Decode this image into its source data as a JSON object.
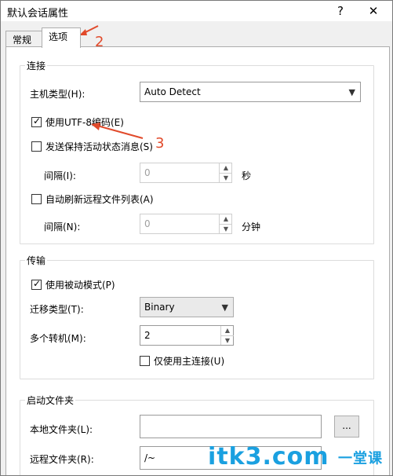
{
  "window": {
    "title": "默认会话属性",
    "help_btn": "?",
    "close_btn": "✕"
  },
  "tabs": [
    {
      "label": "常规"
    },
    {
      "label": "选项"
    }
  ],
  "annotations": {
    "a2": "2",
    "a3": "3"
  },
  "connection": {
    "group_title": "连接",
    "host_type_label": "主机类型(H):",
    "host_type_value": "Auto Detect",
    "utf8_label": "使用UTF-8编码(E)",
    "utf8_checked": true,
    "keepalive_label": "发送保持活动状态消息(S)",
    "keepalive_checked": false,
    "interval1_label": "间隔(I):",
    "interval1_value": "0",
    "interval1_unit": "秒",
    "autorefresh_label": "自动刷新远程文件列表(A)",
    "autorefresh_checked": false,
    "interval2_label": "间隔(N):",
    "interval2_value": "0",
    "interval2_unit": "分钟"
  },
  "transfer": {
    "group_title": "传输",
    "passive_label": "使用被动模式(P)",
    "passive_checked": true,
    "type_label": "迁移类型(T):",
    "type_value": "Binary",
    "multi_label": "多个转机(M):",
    "multi_value": "2",
    "primary_only_label": "仅使用主连接(U)",
    "primary_only_checked": false
  },
  "startup": {
    "group_title": "启动文件夹",
    "local_label": "本地文件夹(L):",
    "local_value": "",
    "browse_label": "...",
    "remote_label": "远程文件夹(R):",
    "remote_value": "/~"
  },
  "watermark": {
    "text": "itk3.com",
    "cn": "一堂课"
  },
  "colors": {
    "annotation": "#e14a2b",
    "watermark": "#1aa0e0"
  }
}
